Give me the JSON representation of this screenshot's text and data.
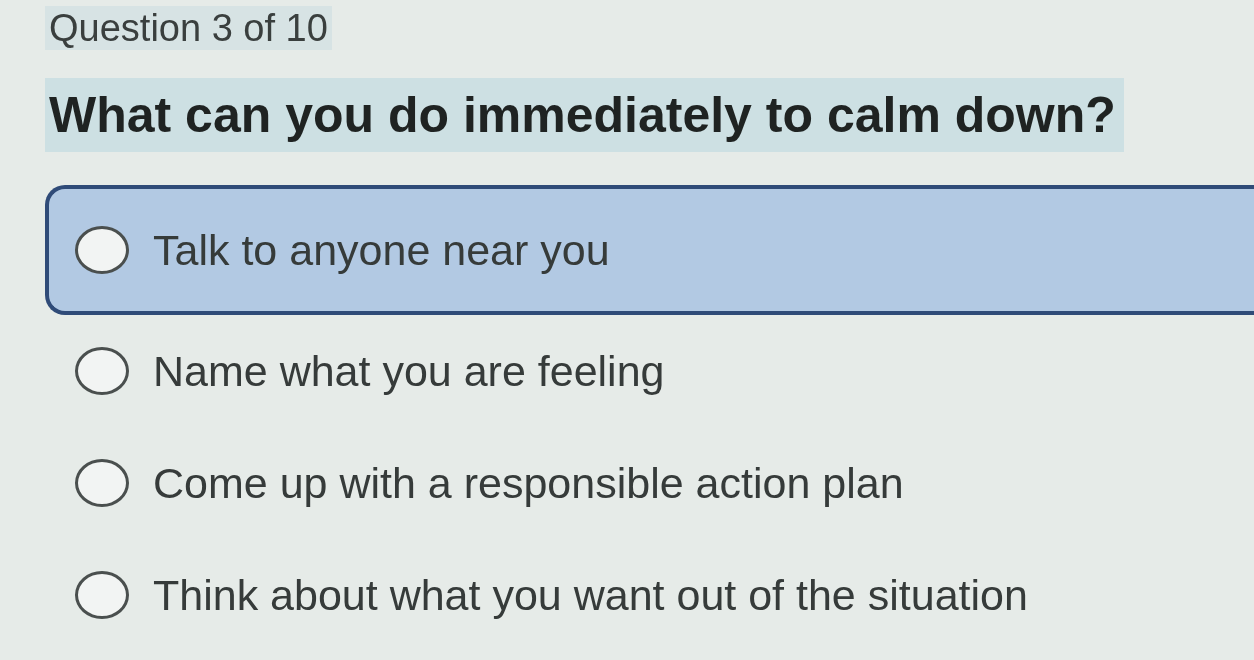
{
  "header": {
    "progress": "Question 3 of 10"
  },
  "question": {
    "text": "What can you do immediately to calm down?"
  },
  "options": [
    {
      "label": "Talk to anyone near you",
      "highlighted": true,
      "checked": false
    },
    {
      "label": "Name what you are feeling",
      "highlighted": false,
      "checked": false
    },
    {
      "label": "Come up with a responsible action plan",
      "highlighted": false,
      "checked": false
    },
    {
      "label": "Think about what you want out of the situation",
      "highlighted": false,
      "checked": false
    }
  ]
}
